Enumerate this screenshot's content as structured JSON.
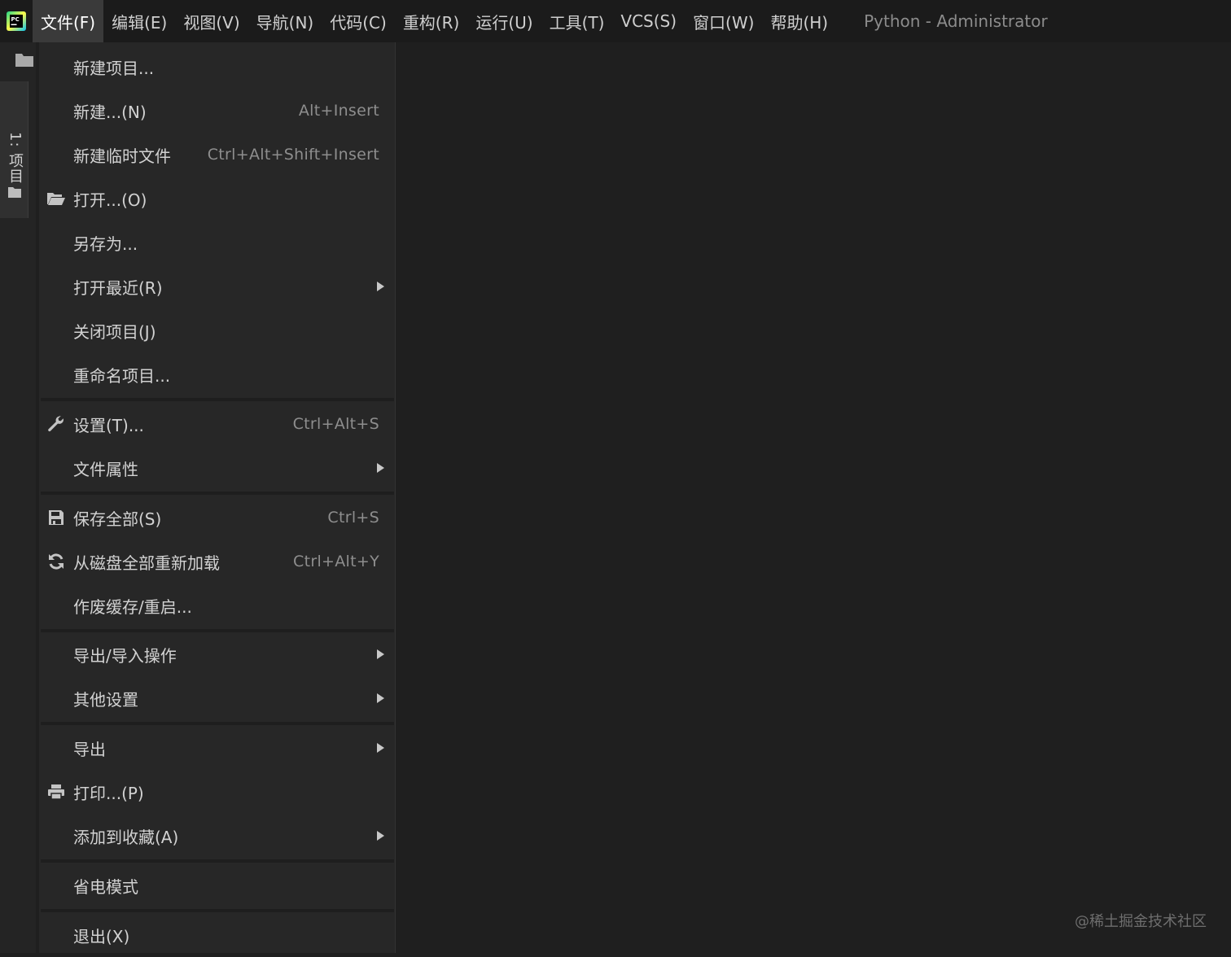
{
  "menubar": {
    "items": [
      {
        "label": "文件(F)",
        "active": true
      },
      {
        "label": "编辑(E)"
      },
      {
        "label": "视图(V)"
      },
      {
        "label": "导航(N)"
      },
      {
        "label": "代码(C)"
      },
      {
        "label": "重构(R)"
      },
      {
        "label": "运行(U)"
      },
      {
        "label": "工具(T)"
      },
      {
        "label": "VCS(S)"
      },
      {
        "label": "窗口(W)"
      },
      {
        "label": "帮助(H)"
      }
    ],
    "window_title": "Python - Administrator"
  },
  "toolstrip": {
    "project_tab_label": "1: 项目"
  },
  "file_menu": {
    "items": [
      {
        "label": "新建项目...",
        "shortcut": ""
      },
      {
        "label": "新建...(N)",
        "shortcut": "Alt+Insert"
      },
      {
        "label": "新建临时文件",
        "shortcut": "Ctrl+Alt+Shift+Insert"
      },
      {
        "label": "打开...(O)",
        "shortcut": "",
        "icon": "folder-open-icon"
      },
      {
        "label": "另存为...",
        "shortcut": ""
      },
      {
        "label": "打开最近(R)",
        "submenu": true
      },
      {
        "label": "关闭项目(J)",
        "shortcut": ""
      },
      {
        "label": "重命名项目...",
        "shortcut": ""
      },
      {
        "label": "设置(T)...",
        "shortcut": "Ctrl+Alt+S",
        "icon": "wrench-icon"
      },
      {
        "label": "文件属性",
        "submenu": true
      },
      {
        "label": "保存全部(S)",
        "shortcut": "Ctrl+S",
        "icon": "save-icon"
      },
      {
        "label": "从磁盘全部重新加载",
        "shortcut": "Ctrl+Alt+Y",
        "icon": "reload-icon"
      },
      {
        "label": "作废缓存/重启...",
        "shortcut": ""
      },
      {
        "label": "导出/导入操作",
        "submenu": true
      },
      {
        "label": "其他设置",
        "submenu": true
      },
      {
        "label": "导出",
        "submenu": true
      },
      {
        "label": "打印...(P)",
        "shortcut": "",
        "icon": "print-icon"
      },
      {
        "label": "添加到收藏(A)",
        "submenu": true
      },
      {
        "label": "省电模式",
        "shortcut": ""
      },
      {
        "label": "退出(X)",
        "shortcut": ""
      }
    ]
  },
  "watermark": "@稀土掘金技术社区",
  "colors": {
    "background": "#1f1f1f",
    "menu_background": "#272727",
    "menubar_background": "#1b1b1b",
    "active_menu": "#3a3a3a",
    "text": "#d2d2d2",
    "shortcut_text": "#8e8e8e"
  }
}
